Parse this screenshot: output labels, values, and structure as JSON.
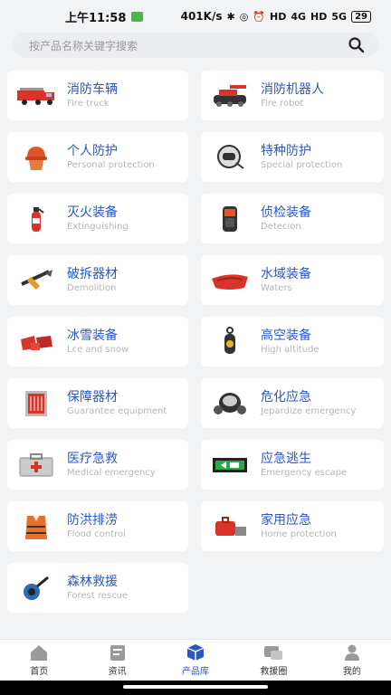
{
  "status_bar": {
    "time": "上午11:58",
    "net_speed": "401K/s",
    "battery": "29",
    "hd1": "HD",
    "hd2": "HD",
    "sig1": "4G",
    "sig2": "5G"
  },
  "search": {
    "placeholder": "按产品名称关键字搜索"
  },
  "categories": [
    {
      "zh": "消防车辆",
      "en": "Fire truck",
      "icon": "fire-truck-icon"
    },
    {
      "zh": "消防机器人",
      "en": "Fire robot",
      "icon": "fire-robot-icon"
    },
    {
      "zh": "个人防护",
      "en": "Personal protection",
      "icon": "helmet-icon"
    },
    {
      "zh": "特种防护",
      "en": "Special protection",
      "icon": "special-helmet-icon"
    },
    {
      "zh": "灭火装备",
      "en": "Extinguishing",
      "icon": "extinguisher-icon"
    },
    {
      "zh": "侦检装备",
      "en": "Detecion",
      "icon": "detector-icon"
    },
    {
      "zh": "破拆器材",
      "en": "Demolition",
      "icon": "demolition-tool-icon"
    },
    {
      "zh": "水域装备",
      "en": "Waters",
      "icon": "boat-icon"
    },
    {
      "zh": "冰雪装备",
      "en": "Lce and snow",
      "icon": "ice-gear-icon"
    },
    {
      "zh": "高空装备",
      "en": "High altitude",
      "icon": "pulley-icon"
    },
    {
      "zh": "保障器材",
      "en": "Guarantee equipment",
      "icon": "guarantee-device-icon"
    },
    {
      "zh": "危化应急",
      "en": "Jepardize emergency",
      "icon": "gas-mask-icon"
    },
    {
      "zh": "医疗急救",
      "en": "Medical emergency",
      "icon": "medical-kit-icon"
    },
    {
      "zh": "应急逃生",
      "en": "Emergency escape",
      "icon": "exit-sign-icon"
    },
    {
      "zh": "防洪排涝",
      "en": "Flood control",
      "icon": "life-vest-icon"
    },
    {
      "zh": "家用应急",
      "en": "Home protection",
      "icon": "home-kit-icon"
    },
    {
      "zh": "森林救援",
      "en": "Forest rescue",
      "icon": "blower-icon"
    }
  ],
  "tabbar": [
    {
      "label": "首页",
      "icon": "home-icon",
      "active": false
    },
    {
      "label": "资讯",
      "icon": "news-icon",
      "active": false
    },
    {
      "label": "产品库",
      "icon": "product-box-icon",
      "active": true
    },
    {
      "label": "救援圈",
      "icon": "rescue-circle-icon",
      "active": false
    },
    {
      "label": "我的",
      "icon": "profile-icon",
      "active": false
    }
  ],
  "colors": {
    "accent": "#2a57c4",
    "red": "#d8342a"
  }
}
